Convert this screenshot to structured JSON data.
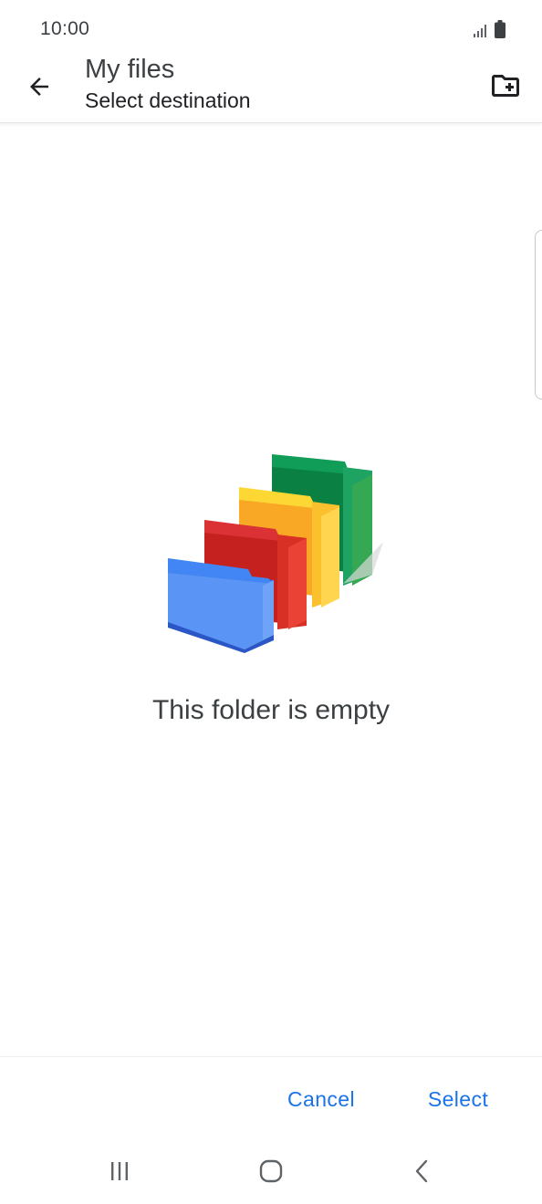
{
  "status_bar": {
    "time": "10:00",
    "signal_icon": "signal-icon",
    "battery_icon": "battery-icon"
  },
  "header": {
    "title": "My files",
    "subtitle": "Select destination",
    "back_icon": "arrow-back-icon",
    "new_folder_icon": "create-new-folder-icon"
  },
  "empty_state": {
    "illustration": "empty-folders-illustration",
    "message": "This folder is empty"
  },
  "actions": {
    "cancel_label": "Cancel",
    "select_label": "Select"
  },
  "nav_bar": {
    "recents_icon": "recents-icon",
    "home_icon": "home-icon",
    "back_icon": "nav-back-icon"
  },
  "colors": {
    "accent": "#1a73e8",
    "folder_blue": "#4285f4",
    "folder_red": "#db3236",
    "folder_yellow": "#fbc02d",
    "folder_green": "#0f9d58"
  }
}
